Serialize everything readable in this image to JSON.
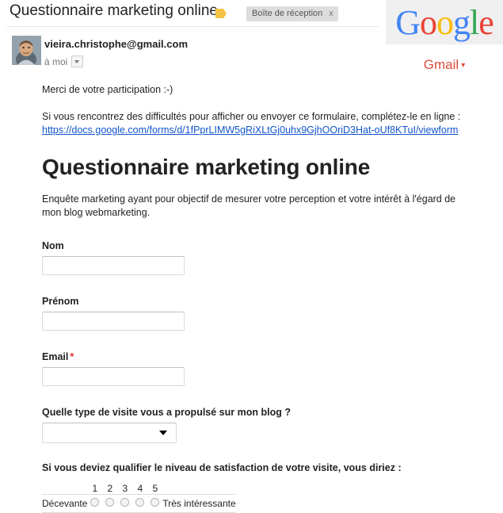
{
  "brand": {
    "google_logo_letters": [
      {
        "char": "G",
        "color": "#4285f4"
      },
      {
        "char": "o",
        "color": "#ea4335"
      },
      {
        "char": "o",
        "color": "#fbbc05"
      },
      {
        "char": "g",
        "color": "#4285f4"
      },
      {
        "char": "l",
        "color": "#34a853"
      },
      {
        "char": "e",
        "color": "#ea4335"
      }
    ],
    "gmail_label": "Gmail",
    "gmail_caret": "▾",
    "gmail_color": "#dd4b39"
  },
  "mail": {
    "subject": "Questionnaire marketing online",
    "label_icon": "label-tag-icon",
    "inbox_chip": "Boîte de réception",
    "inbox_chip_close": "x",
    "sender_email": "vieira.christophe@gmail.com",
    "recipient": "à moi",
    "avatar_alt": "sender-avatar"
  },
  "body": {
    "thanks_line": "Merci de votre participation :-)",
    "trouble_line": "Si vous rencontrez des difficultés pour afficher ou envoyer ce formulaire, complétez-le en ligne :",
    "form_url": "https://docs.google.com/forms/d/1fPprLIMW5gRiXLtGj0uhx9GjhOOriD3Hat-oUf8KTuI/viewform"
  },
  "form": {
    "title": "Questionnaire marketing online",
    "description": "Enquête marketing ayant pour objectif de mesurer votre perception et votre intérêt à l'égard de mon blog webmarketing.",
    "fields": [
      {
        "label": "Nom",
        "value": "",
        "placeholder": "",
        "required": false,
        "type": "text"
      },
      {
        "label": "Prénom",
        "value": "",
        "placeholder": "",
        "required": false,
        "type": "text"
      },
      {
        "label": "Email",
        "value": "",
        "placeholder": "",
        "required": true,
        "required_marker": "*",
        "type": "text"
      }
    ],
    "select_question": {
      "label": "Quelle type de visite vous a propulsé sur mon blog ?",
      "selected": "",
      "options": [
        ""
      ]
    },
    "rating_question": {
      "label": "Si vous deviez qualifier le niveau de satisfaction de votre visite, vous diriez :",
      "scale": [
        "1",
        "2",
        "3",
        "4",
        "5"
      ],
      "low_label": "Décevante",
      "high_label": "Très intéressante",
      "selected": null
    }
  }
}
